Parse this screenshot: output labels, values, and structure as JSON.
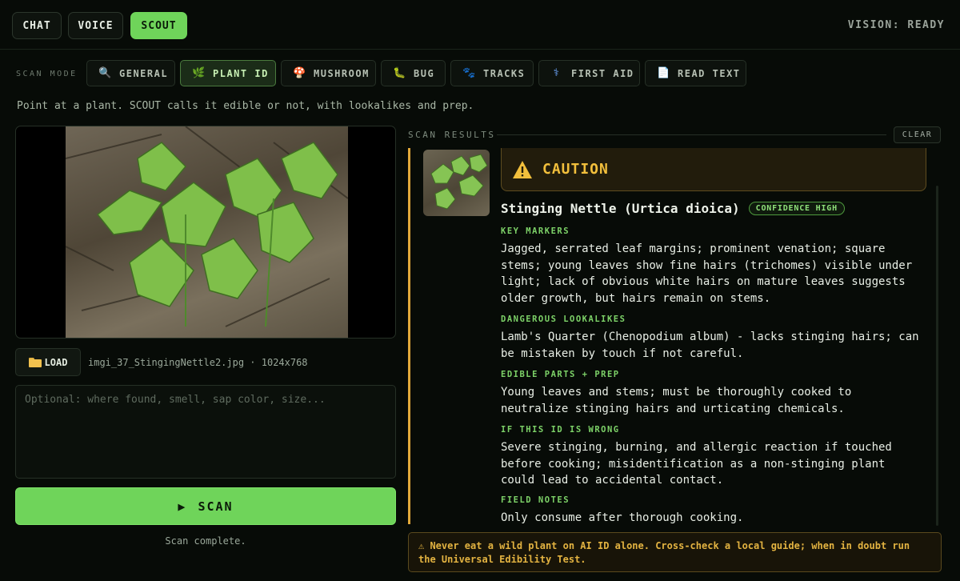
{
  "tabs": [
    {
      "label": "CHAT",
      "active": false
    },
    {
      "label": "VOICE",
      "active": false
    },
    {
      "label": "SCOUT",
      "active": true
    }
  ],
  "status": "VISION: READY",
  "scan_mode": {
    "label": "SCAN MODE",
    "modes": [
      {
        "icon": "magnifier-icon",
        "glyph": "🔍",
        "label": "GENERAL",
        "active": false
      },
      {
        "icon": "plant-icon",
        "glyph": "🌿",
        "label": "PLANT ID",
        "active": true
      },
      {
        "icon": "mushroom-icon",
        "glyph": "🍄",
        "label": "MUSHROOM",
        "active": false
      },
      {
        "icon": "bug-icon",
        "glyph": "🐛",
        "label": "BUG",
        "active": false
      },
      {
        "icon": "paw-prints-icon",
        "glyph": "🐾",
        "label": "TRACKS",
        "active": false
      },
      {
        "icon": "medical-icon",
        "glyph": "⚕",
        "label": "FIRST AID",
        "active": false
      },
      {
        "icon": "document-icon",
        "glyph": "📄",
        "label": "READ TEXT",
        "active": false
      }
    ]
  },
  "hint": "Point at a plant. SCOUT calls it edible or not, with lookalikes and prep.",
  "image": {
    "load_label": "LOAD",
    "file_info": "imgi_37_StingingNettle2.jpg · 1024x768"
  },
  "notes": {
    "placeholder": "Optional: where found, smell, sap color, size...",
    "value": ""
  },
  "scan": {
    "label": "SCAN",
    "status": "Scan complete."
  },
  "results": {
    "label": "SCAN RESULTS",
    "clear_label": "CLEAR",
    "verdict": "CAUTION",
    "species": "Stinging Nettle (Urtica dioica)",
    "confidence": "CONFIDENCE HIGH",
    "sections": [
      {
        "heading": "KEY MARKERS",
        "body": "Jagged, serrated leaf margins; prominent venation; square stems; young leaves show fine hairs (trichomes) visible under light; lack of obvious white hairs on mature leaves suggests older growth, but hairs remain on stems."
      },
      {
        "heading": "DANGEROUS LOOKALIKES",
        "body": "Lamb's Quarter (Chenopodium album) - lacks stinging hairs; can be mistaken by touch if not careful."
      },
      {
        "heading": "EDIBLE PARTS + PREP",
        "body": "Young leaves and stems; must be thoroughly cooked to neutralize stinging hairs and urticating chemicals."
      },
      {
        "heading": "IF THIS ID IS WRONG",
        "body": "Severe stinging, burning, and allergic reaction if touched before cooking; misidentification as a non-stinging plant could lead to accidental contact."
      },
      {
        "heading": "FIELD NOTES",
        "body": "Only consume after thorough cooking."
      }
    ]
  },
  "warning": "⚠ Never eat a wild plant on AI ID alone. Cross-check a local guide; when in doubt run the Universal Edibility Test.",
  "colors": {
    "accent": "#6fd45a",
    "caution": "#f2bf3c",
    "background": "#070b07"
  }
}
